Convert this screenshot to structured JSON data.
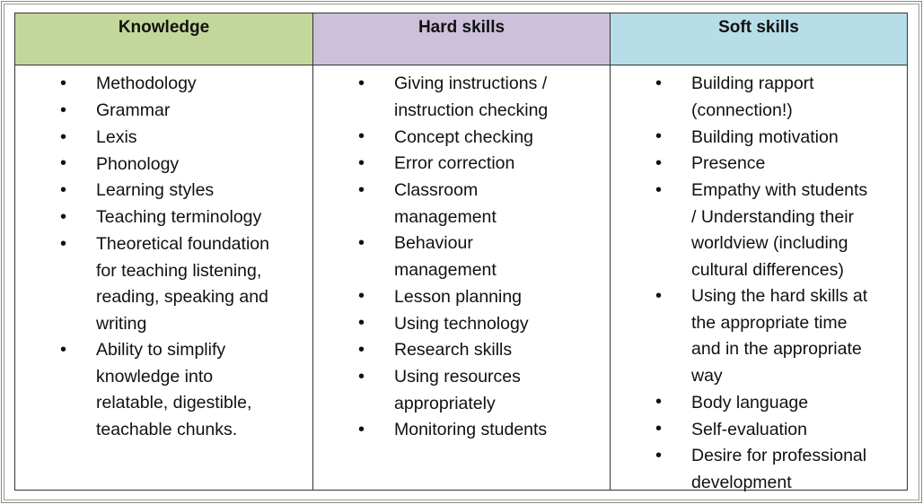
{
  "colors": {
    "knowledge_header": "#c4d79b",
    "hard_header": "#ccc0da",
    "soft_header": "#b7dee8"
  },
  "columns": [
    {
      "header": "Knowledge",
      "items": [
        "Methodology",
        "Grammar",
        "Lexis",
        "Phonology",
        "Learning styles",
        "Teaching terminology",
        "Theoretical foundation\nfor teaching listening,\nreading, speaking and\nwriting",
        "Ability to simplify\nknowledge into\nrelatable, digestible,\nteachable chunks."
      ]
    },
    {
      "header": "Hard skills",
      "items": [
        "Giving instructions /\ninstruction checking",
        "Concept checking",
        "Error correction",
        "Classroom\nmanagement",
        "Behaviour\nmanagement",
        "Lesson planning",
        "Using technology",
        "Research skills",
        "Using resources\nappropriately",
        "Monitoring students"
      ]
    },
    {
      "header": "Soft skills",
      "items": [
        "Building rapport\n(connection!)",
        "Building motivation",
        "Presence",
        "Empathy with students\n/ Understanding their\nworldview (including\ncultural differences)",
        "Using the hard skills at\nthe appropriate time\nand in the appropriate\nway",
        "Body language",
        "Self-evaluation",
        "Desire for professional\ndevelopment"
      ]
    }
  ]
}
